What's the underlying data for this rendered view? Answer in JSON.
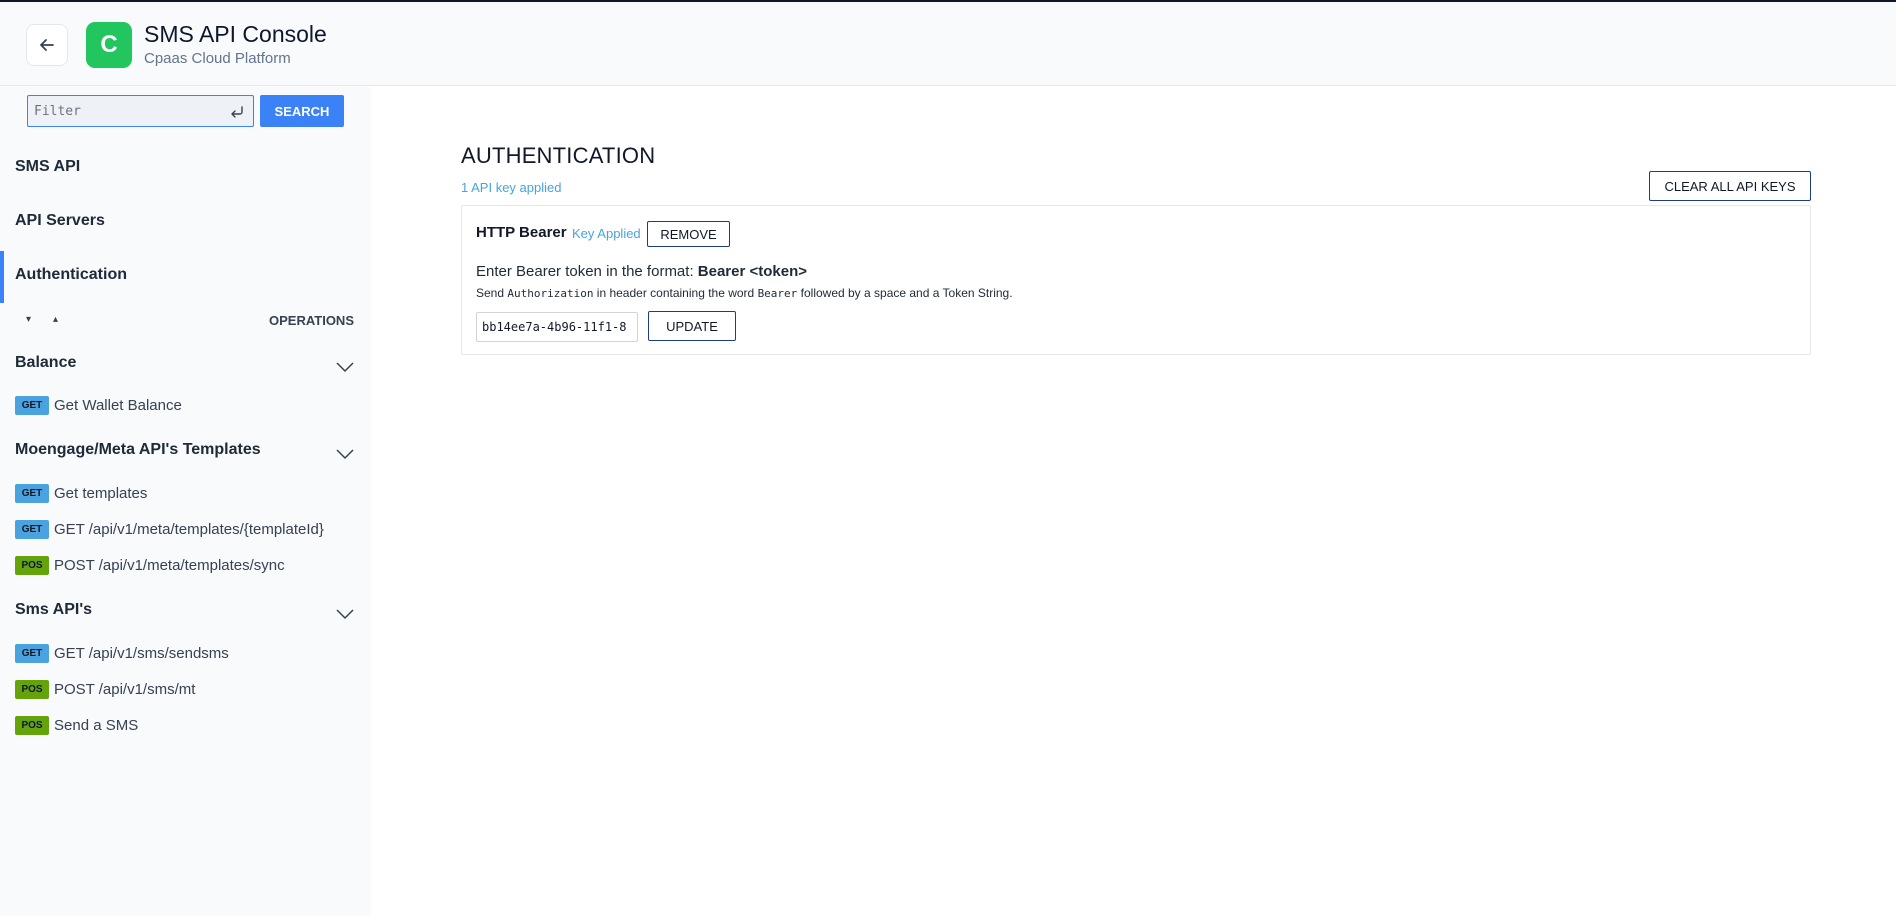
{
  "header": {
    "title": "SMS API Console",
    "subtitle": "Cpaas Cloud Platform",
    "logo_letter": "C",
    "logo_color": "#22c55e",
    "back_icon": "arrow-left-icon"
  },
  "sidebar": {
    "filter_placeholder": "Filter",
    "filter_value": "",
    "search_label": "SEARCH",
    "nav": [
      {
        "label": "SMS API"
      },
      {
        "label": "API Servers"
      },
      {
        "label": "Authentication",
        "active": true
      }
    ],
    "operations_label": "OPERATIONS",
    "expand_all_glyph": "▾",
    "collapse_all_glyph": "▴",
    "groups": [
      {
        "title": "Balance",
        "ops": [
          {
            "method": "GET",
            "label": "Get Wallet Balance"
          }
        ]
      },
      {
        "title": "Moengage/Meta API's Templates",
        "ops": [
          {
            "method": "GET",
            "label": "Get templates"
          },
          {
            "method": "GET",
            "label": "GET /api/v1/meta/templates/{templateId}"
          },
          {
            "method": "POS",
            "label": "POST /api/v1/meta/templates/sync"
          }
        ]
      },
      {
        "title": "Sms API's",
        "ops": [
          {
            "method": "GET",
            "label": "GET /api/v1/sms/sendsms"
          },
          {
            "method": "POS",
            "label": "POST /api/v1/sms/mt"
          },
          {
            "method": "POS",
            "label": "Send a SMS"
          }
        ]
      }
    ]
  },
  "main": {
    "title": "AUTHENTICATION",
    "applied_count": "1 API key applied",
    "clear_label": "CLEAR ALL API KEYS",
    "scheme": {
      "name": "HTTP Bearer",
      "status": "Key Applied",
      "remove_label": "REMOVE",
      "desc_prefix": "Enter Bearer token in the format: ",
      "desc_format": "Bearer <token>",
      "desc2_send": "Send ",
      "desc2_header": "Authorization",
      "desc2_mid": " in header containing the word ",
      "desc2_word": "Bearer",
      "desc2_end": " followed by a space and a Token String.",
      "token_value": "bb14ee7a-4b96-11f1-8",
      "update_label": "UPDATE"
    }
  },
  "colors": {
    "accent": "#3b82f6",
    "get_badge": "#4aa3df",
    "post_badge": "#65a30d",
    "link": "#4aa3df"
  }
}
